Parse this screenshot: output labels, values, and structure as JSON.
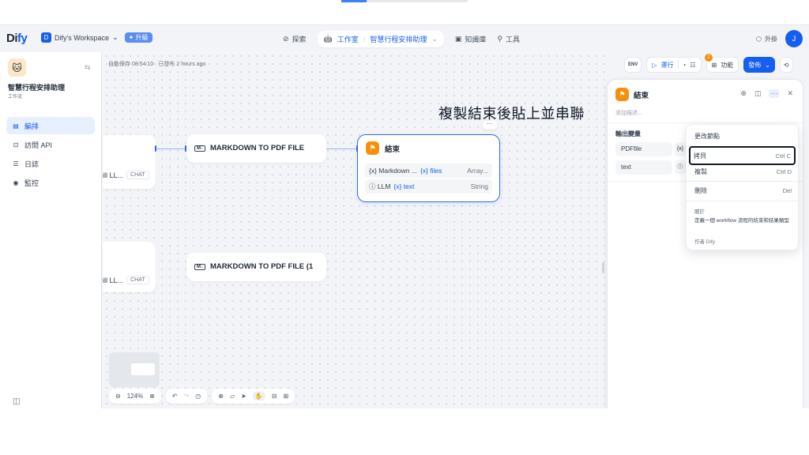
{
  "header": {
    "logo_main": "Di",
    "logo_accent": "fy",
    "workspace_initial": "D",
    "workspace_name": "Dify's Workspace",
    "upgrade_label": "✦ 升級",
    "nav_explore": "探索",
    "nav_studio": "工作室",
    "nav_current_app": "智慧行程安排助理",
    "nav_knowledge": "知識庫",
    "nav_tools": "工具",
    "plugins_label": "外掛",
    "avatar_initial": "J"
  },
  "sidebar": {
    "app_name": "智慧行程安排助理",
    "app_type": "工作流",
    "items": [
      {
        "label": "編排",
        "icon": "layout-icon"
      },
      {
        "label": "訪問 API",
        "icon": "terminal-icon"
      },
      {
        "label": "日誌",
        "icon": "log-icon"
      },
      {
        "label": "監控",
        "icon": "monitor-icon"
      }
    ]
  },
  "canvas": {
    "save_status": "自動保存 08:54:10 · 已發布 2 hours ago",
    "annotation": "複製結束後貼上並串聯",
    "partial_node_1": "ill LL...",
    "partial_node_2": "ill LL...",
    "chat_tag": "CHAT",
    "md_badge": "M↓",
    "md_node_1": "MARKDOWN TO PDF FILE",
    "md_node_2": "MARKDOWN TO PDF FILE (1",
    "end_node": {
      "title": "結束",
      "rows": [
        {
          "source": "{x} Markdown ...",
          "var": "{x} files",
          "type": "Array..."
        },
        {
          "source": "ⓘ LLM",
          "var": "{x} text",
          "type": "String"
        }
      ],
      "more": "···"
    },
    "zoom": "124%"
  },
  "actions": {
    "run_label": "運行",
    "features_label": "功能",
    "publish_label": "發佈",
    "notification_count": "2"
  },
  "panel": {
    "title": "結束",
    "description_placeholder": "添加描述...",
    "output_label": "輸出變量",
    "outputs": [
      {
        "name": "PDFfile",
        "chip": "{x}"
      },
      {
        "name": "text",
        "chip": "ⓘ"
      }
    ]
  },
  "context_menu": {
    "change_node": "更改節點",
    "copy": "拷貝",
    "copy_kbd": "Ctrl C",
    "duplicate": "複製",
    "duplicate_kbd": "Ctrl D",
    "delete": "刪除",
    "delete_kbd": "Del",
    "about_label": "關於",
    "about_desc": "定義一個 workflow 流程的結束和結果類型",
    "author": "作者 Dify"
  }
}
